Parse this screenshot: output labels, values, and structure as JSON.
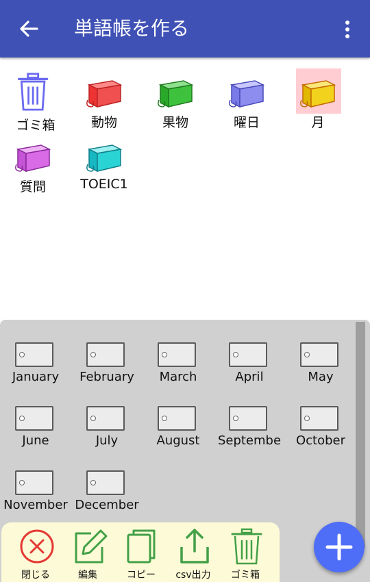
{
  "header": {
    "title": "単語帳を作る",
    "back_icon": "arrow-left-icon",
    "menu_icon": "more-vert-icon"
  },
  "folders": [
    {
      "label": "ゴミ箱",
      "icon": "trash-icon"
    },
    {
      "label": "動物",
      "color": "#f05050"
    },
    {
      "label": "果物",
      "color": "#3ec23e"
    },
    {
      "label": "曜日",
      "color": "#8d8df0"
    },
    {
      "label": "月",
      "color": "#f2d21c",
      "selected": true
    },
    {
      "label": "質問",
      "color": "#d96be6"
    },
    {
      "label": "TOEIC1",
      "color": "#2ad4d4"
    }
  ],
  "books": [
    "January",
    "February",
    "March",
    "April",
    "May",
    "June",
    "July",
    "August",
    "Septembe",
    "October",
    "November",
    "December"
  ],
  "toolbar": {
    "close": "閉じる",
    "edit": "編集",
    "copy": "コピー",
    "csv": "csv出力",
    "trash": "ゴミ箱"
  },
  "colors": {
    "appbar": "#3f51b5",
    "fab": "#4f6ef7",
    "accent_red": "#e53935",
    "accent_green": "#43a047"
  }
}
